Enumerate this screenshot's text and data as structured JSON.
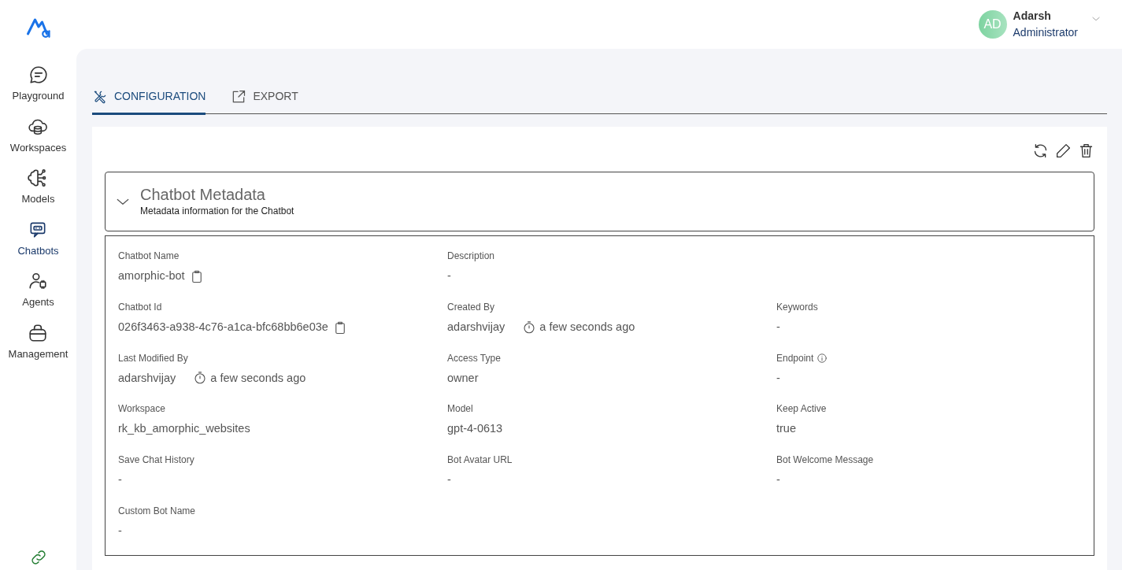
{
  "sidebar": {
    "items": [
      {
        "label": "Playground",
        "kind": "chat",
        "selected": false
      },
      {
        "label": "Workspaces",
        "kind": "cloud",
        "selected": false
      },
      {
        "label": "Models",
        "kind": "brain",
        "selected": false
      },
      {
        "label": "Chatbots",
        "kind": "bot",
        "selected": true
      },
      {
        "label": "Agents",
        "kind": "agent",
        "selected": false
      },
      {
        "label": "Management",
        "kind": "briefcase",
        "selected": false
      }
    ]
  },
  "user": {
    "initials": "AD",
    "name": "Adarsh",
    "role": "Administrator"
  },
  "tabs": [
    {
      "label": "CONFIGURATION",
      "kind": "tools",
      "selected": true
    },
    {
      "label": "EXPORT",
      "kind": "export",
      "selected": false
    }
  ],
  "section": {
    "title": "Chatbot Metadata",
    "subtitle": "Metadata information for the Chatbot",
    "expanded": true
  },
  "rows": [
    [
      {
        "label": "Chatbot Name",
        "kind": "copy",
        "value": "amorphic-bot"
      },
      {
        "label": "Description",
        "kind": "plain",
        "value": "-"
      }
    ],
    [
      {
        "label": "Chatbot Id",
        "kind": "copy",
        "value": "026f3463-a938-4c76-a1ca-bfc68bb6e03e"
      },
      {
        "label": "Created By",
        "kind": "audit",
        "value": "adarshvijay",
        "time": "a few seconds ago"
      },
      {
        "label": "Keywords",
        "kind": "plain",
        "value": "-"
      }
    ],
    [
      {
        "label": "Last Modified By",
        "kind": "audit",
        "value": "adarshvijay",
        "time": "a few seconds ago"
      },
      {
        "label": "Access Type",
        "kind": "plain",
        "value": "owner"
      },
      {
        "label": "Endpoint",
        "kind": "plain",
        "info": true,
        "value": "-"
      }
    ],
    [
      {
        "label": "Workspace",
        "kind": "plain",
        "value": "rk_kb_amorphic_websites"
      },
      {
        "label": "Model",
        "kind": "plain",
        "value": "gpt-4-0613"
      },
      {
        "label": "Keep Active",
        "kind": "plain",
        "value": "true"
      }
    ],
    [
      {
        "label": "Save Chat History",
        "kind": "plain",
        "value": "-"
      },
      {
        "label": "Bot Avatar URL",
        "kind": "plain",
        "value": "-"
      },
      {
        "label": "Bot Welcome Message",
        "kind": "plain",
        "value": "-"
      }
    ],
    [
      {
        "label": "Custom Bot Name",
        "kind": "plain",
        "value": "-"
      }
    ]
  ]
}
